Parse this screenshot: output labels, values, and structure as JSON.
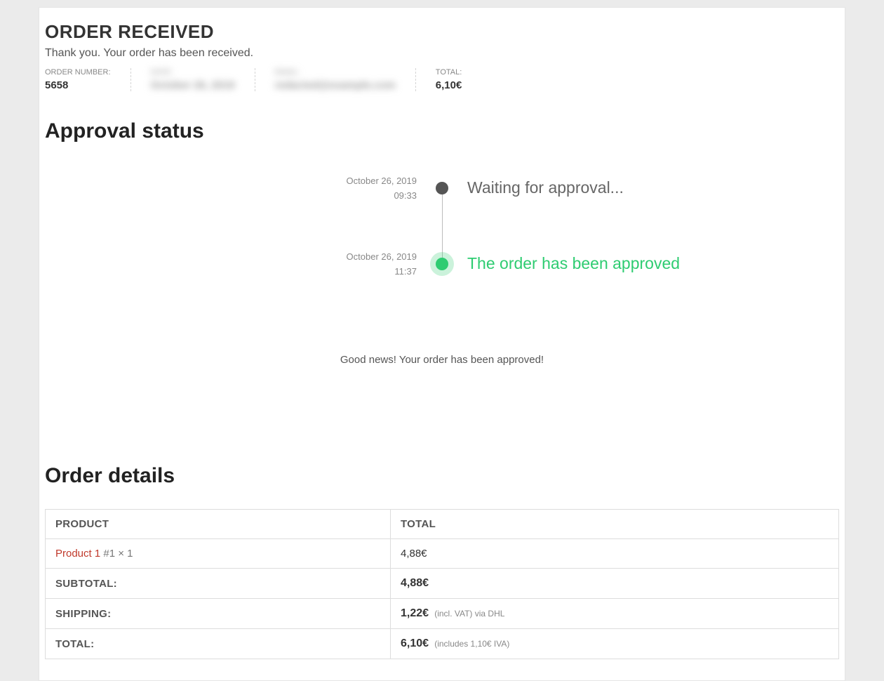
{
  "header": {
    "title": "ORDER RECEIVED",
    "thank_you": "Thank you. Your order has been received."
  },
  "summary": {
    "order_number_label": "ORDER NUMBER:",
    "order_number_value": "5658",
    "date_label": "DATE:",
    "date_value": "October 26, 2019",
    "email_label": "EMAIL:",
    "email_value": "redacted@example.com",
    "total_label": "TOTAL:",
    "total_value": "6,10€"
  },
  "approval": {
    "heading": "Approval status",
    "events": [
      {
        "date": "October 26, 2019",
        "time": "09:33",
        "title": "Waiting for approval...",
        "status": "pending"
      },
      {
        "date": "October 26, 2019",
        "time": "11:37",
        "title": "The order has been approved",
        "status": "approved"
      }
    ],
    "message": "Good news! Your order has been approved!"
  },
  "details": {
    "heading": "Order details",
    "columns": {
      "product": "PRODUCT",
      "total": "TOTAL"
    },
    "items": [
      {
        "name": "Product 1",
        "meta": " #1 × 1",
        "price": "4,88€"
      }
    ],
    "subtotal_label": "SUBTOTAL:",
    "subtotal_value": "4,88€",
    "shipping_label": "SHIPPING:",
    "shipping_value": "1,22€",
    "shipping_note": "(incl. VAT) via DHL",
    "total_label": "TOTAL:",
    "total_value": "6,10€",
    "total_note": "(includes 1,10€   IVA)"
  }
}
